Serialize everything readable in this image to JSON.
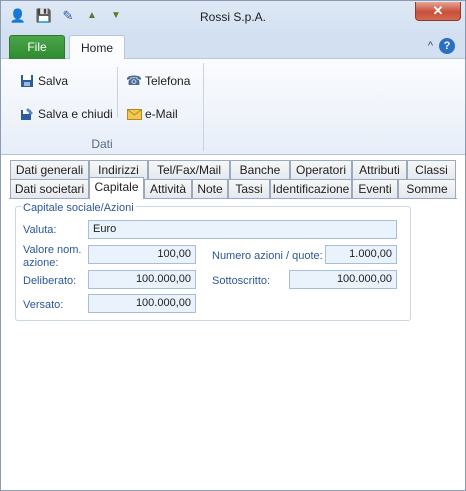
{
  "window": {
    "title": "Rossi S.p.A.",
    "close_glyph": "✕"
  },
  "quick_access": [
    {
      "name": "user-icon",
      "glyph": "👤",
      "color": "#d99c2b"
    },
    {
      "name": "save-icon",
      "glyph": "💾",
      "color": "#2d5c9c"
    },
    {
      "name": "edit-icon",
      "glyph": "✎",
      "color": "#2d5c9c"
    },
    {
      "name": "arrow-up-icon",
      "glyph": "▲",
      "color": "#5b7a27"
    },
    {
      "name": "arrow-down-icon",
      "glyph": "▼",
      "color": "#5b7a27"
    }
  ],
  "ribbon": {
    "file_tab": "File",
    "home_tab": "Home",
    "minimize_glyph": "^",
    "help_glyph": "?",
    "buttons": {
      "salva": "Salva",
      "salva_chiudi": "Salva e chiudi",
      "telefona": "Telefona",
      "email": "e-Mail"
    },
    "group_label": "Dati"
  },
  "tabs": {
    "row1": [
      "Dati generali",
      "Indirizzi",
      "Tel/Fax/Mail",
      "Banche",
      "Operatori",
      "Attributi",
      "Classi"
    ],
    "row2": [
      "Dati societari",
      "Capitale",
      "Attività",
      "Note",
      "Tassi",
      "Identificazione",
      "Eventi",
      "Somme"
    ],
    "active": "Capitale"
  },
  "form": {
    "group_title": "Capitale sociale/Azioni",
    "valuta_label": "Valuta:",
    "valuta_value": "Euro",
    "valore_label_1": "Valore nom.",
    "valore_label_2": "azione:",
    "valore_value": "100,00",
    "numero_label": "Numero azioni / quote:",
    "numero_value": "1.000,00",
    "deliberato_label": "Deliberato:",
    "deliberato_value": "100.000,00",
    "sottoscritto_label": "Sottoscritto:",
    "sottoscritto_value": "100.000,00",
    "versato_label": "Versato:",
    "versato_value": "100.000,00"
  },
  "colors": {
    "accent_label": "#2b5797",
    "file_tab": "#3a9a3c",
    "field_bg": "#eaf3fb",
    "close_button": "#c7503a"
  }
}
